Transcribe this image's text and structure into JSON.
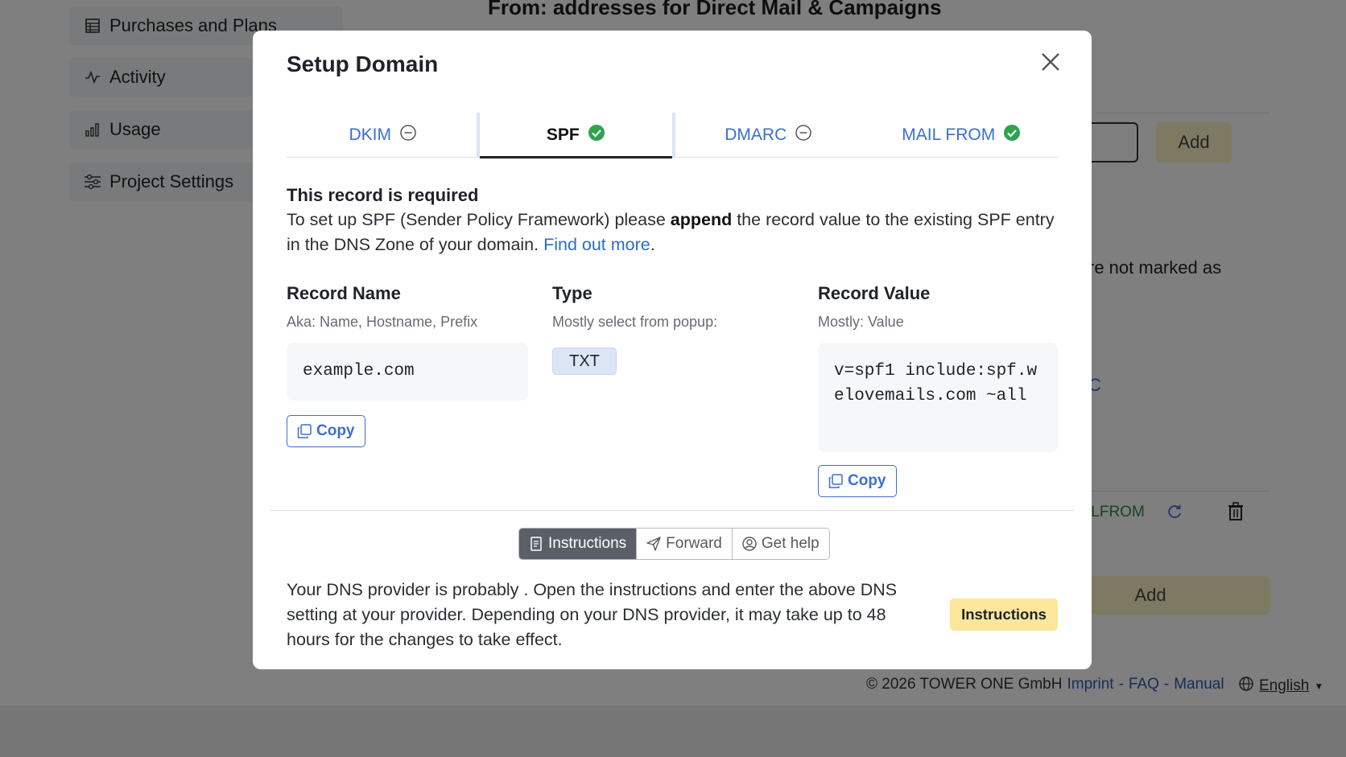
{
  "background": {
    "sidebar": {
      "items": [
        {
          "label": "Purchases and Plans",
          "icon": "table-icon"
        },
        {
          "label": "Activity",
          "icon": "activity-icon"
        },
        {
          "label": "Usage",
          "icon": "bar-chart-icon"
        },
        {
          "label": "Project Settings",
          "icon": "sliders-icon"
        }
      ]
    },
    "heading": "From: addresses for Direct Mail & Campaigns",
    "add_top_label": "Add",
    "partial_text": "re not marked as",
    "partial_link": "C",
    "partial_mailfrom": "ILFROM",
    "add_bottom_label": "Add",
    "footer": {
      "copyright": "© 2026 TOWER ONE GmbH",
      "links": [
        "Imprint",
        "FAQ",
        "Manual"
      ],
      "separator": "-",
      "language": "English"
    }
  },
  "modal": {
    "title": "Setup Domain",
    "tabs": [
      {
        "label": "DKIM",
        "status": "pending"
      },
      {
        "label": "SPF",
        "status": "ok"
      },
      {
        "label": "DMARC",
        "status": "pending"
      },
      {
        "label": "MAIL FROM",
        "status": "ok"
      }
    ],
    "active_tab": "SPF",
    "required_title": "This record is required",
    "description": {
      "part1": "To set up SPF (Sender Policy Framework) please ",
      "bold": "append",
      "part2": " the record value to the existing SPF entry in the DNS Zone of your domain. ",
      "link": "Find out more",
      "end": "."
    },
    "record_name": {
      "label": "Record Name",
      "hint": "Aka: Name, Hostname, Prefix",
      "value": "example.com",
      "copy_label": "Copy"
    },
    "type": {
      "label": "Type",
      "hint": "Mostly select from popup:",
      "value": "TXT"
    },
    "record_value": {
      "label": "Record Value",
      "hint": "Mostly: Value",
      "value": "v=spf1 include:spf.welovemails.com ~all",
      "copy_label": "Copy"
    },
    "segments": [
      {
        "label": "Instructions",
        "icon": "document-icon",
        "active": true
      },
      {
        "label": "Forward",
        "icon": "send-icon",
        "active": false
      },
      {
        "label": "Get help",
        "icon": "user-circle-icon",
        "active": false
      }
    ],
    "provider_text": "Your DNS provider is probably .  Open the instructions and enter the above DNS setting at your provider. Depending on your DNS provider, it may take up to 48 hours for the changes to take effect.",
    "instructions_button": "Instructions"
  },
  "colors": {
    "accent": "#3b6fd1",
    "ok_green": "#2ea44f",
    "highlight_yellow": "#fbe69a"
  }
}
